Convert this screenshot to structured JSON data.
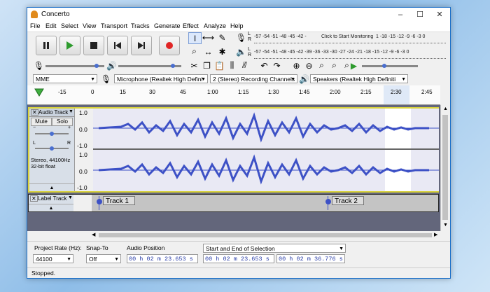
{
  "window": {
    "title": "Concerto",
    "minimize": "–",
    "maximize": "☐",
    "close": "✕"
  },
  "menu": [
    "File",
    "Edit",
    "Select",
    "View",
    "Transport",
    "Tracks",
    "Generate",
    "Effect",
    "Analyze",
    "Help"
  ],
  "meters": {
    "record_scale": "-57 -54 -51 -48 -45 -42 -",
    "record_hint": "Click to Start Monitoring",
    "record_scale_right": "1 -18 -15 -12 -9 -6 -3 0",
    "playback_scale": "-57 -54 -51 -48 -45 -42 -39 -36 -33 -30 -27 -24 -21 -18 -15 -12 -9 -6 -3 0",
    "L": "L",
    "R": "R"
  },
  "devices": {
    "host": "MME",
    "recording": "Microphone (Realtek High Defini",
    "channels": "2 (Stereo) Recording Channels",
    "playback": "Speakers (Realtek High Definiti"
  },
  "ruler": [
    "-15",
    "0",
    "15",
    "30",
    "45",
    "1:00",
    "1:15",
    "1:30",
    "1:45",
    "2:00",
    "2:15",
    "2:30",
    "2:45"
  ],
  "audio_track": {
    "name": "Audio Track",
    "mute": "Mute",
    "solo": "Solo",
    "L": "L",
    "R": "R",
    "info1": "Stereo, 44100Hz",
    "info2": "32-bit float",
    "scale_top": [
      "1.0",
      "0.0",
      "-1.0"
    ],
    "scale_bottom": [
      "1.0",
      "0.0",
      "-1.0"
    ],
    "close": "✕"
  },
  "label_track": {
    "name": "Label Track",
    "close": "✕",
    "labels": [
      "Track 1",
      "Track 2"
    ]
  },
  "selection": {
    "project_rate_label": "Project Rate (Hz):",
    "project_rate": "44100",
    "snap_label": "Snap-To",
    "snap": "Off",
    "audio_position_label": "Audio Position",
    "selection_mode": "Start and End of Selection",
    "audio_position": "00 h 02 m 23.653 s",
    "sel_start": "00 h 02 m 23.653 s",
    "sel_end": "00 h 02 m 36.776 s"
  },
  "status": "Stopped."
}
